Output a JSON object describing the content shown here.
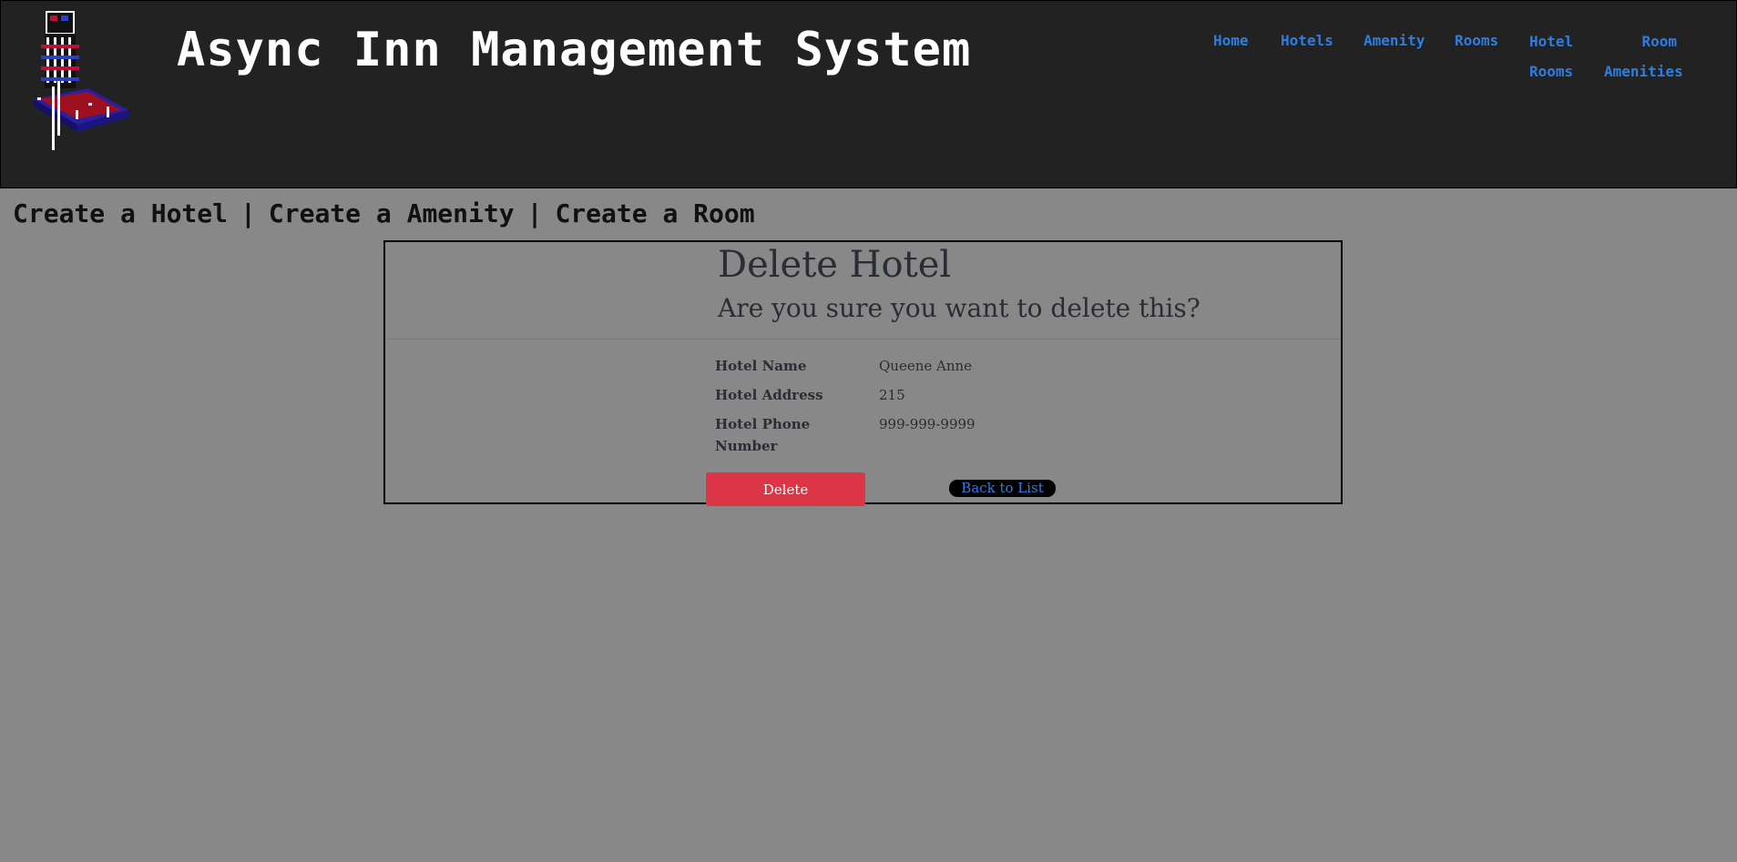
{
  "header": {
    "site_title": "Async Inn Management System",
    "logo_icon": "hotel-tower-logo",
    "nav": {
      "home": "Home",
      "hotels": "Hotels",
      "amenity": "Amenity",
      "rooms": "Rooms",
      "hotel_rooms_line1": "Hotel",
      "hotel_rooms_line2": "Rooms",
      "room_amenities_line1": "Room",
      "room_amenities_line2": "Amenities"
    }
  },
  "subnav": {
    "create_hotel": "Create a Hotel",
    "create_amenity": "Create a Amenity",
    "create_room": "Create a Room",
    "separator": "|"
  },
  "card": {
    "title": "Delete Hotel",
    "subtitle": "Are you sure you want to delete this?",
    "fields": [
      {
        "label": "Hotel Name",
        "value": "Queene Anne"
      },
      {
        "label": "Hotel Address",
        "value": "215"
      },
      {
        "label": "Hotel Phone Number",
        "value": "999-999-9999"
      }
    ],
    "delete_label": "Delete",
    "back_label": "Back to List"
  },
  "colors": {
    "header_bg": "#222222",
    "page_bg": "#888888",
    "link": "#2f7de1",
    "danger": "#dc3545"
  }
}
